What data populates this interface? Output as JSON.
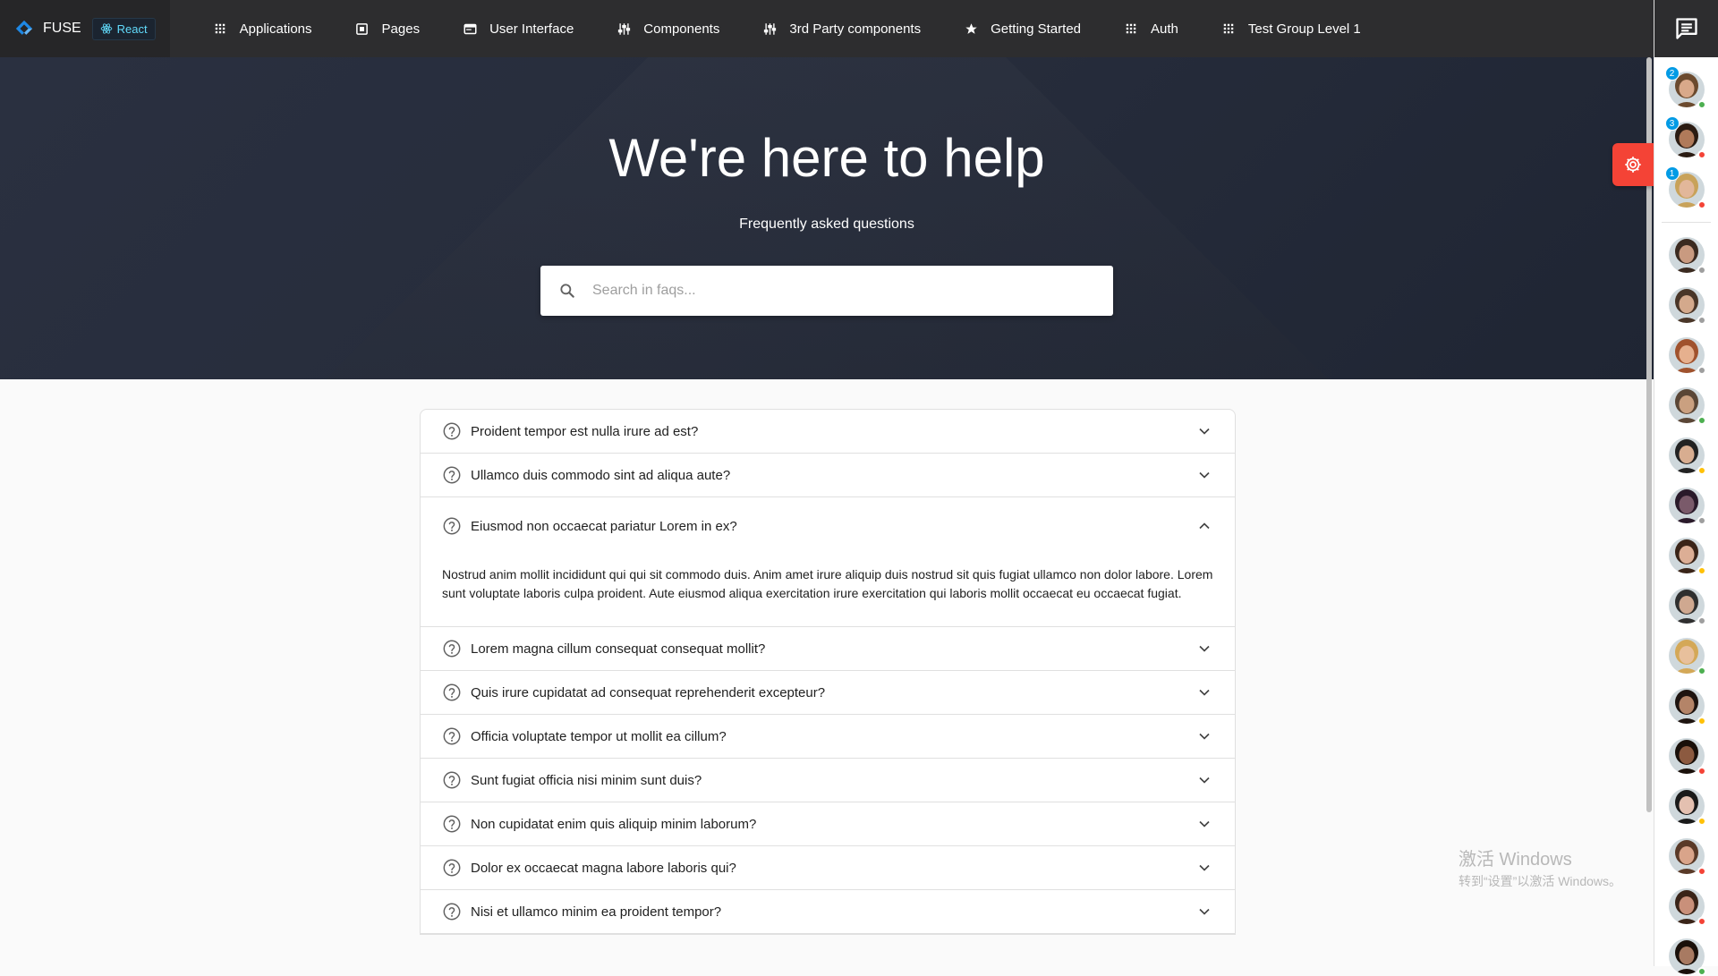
{
  "brand": {
    "name": "FUSE",
    "badge": "React"
  },
  "nav": [
    {
      "label": "Applications",
      "icon": "apps-icon"
    },
    {
      "label": "Pages",
      "icon": "pages-icon"
    },
    {
      "label": "User Interface",
      "icon": "web-icon"
    },
    {
      "label": "Components",
      "icon": "tune-icon"
    },
    {
      "label": "3rd Party components",
      "icon": "tune-icon"
    },
    {
      "label": "Getting Started",
      "icon": "star-icon"
    },
    {
      "label": "Auth",
      "icon": "apps-icon"
    },
    {
      "label": "Test Group Level 1",
      "icon": "apps-icon"
    }
  ],
  "hero": {
    "title": "We're here to help",
    "subtitle": "Frequently asked questions",
    "search_placeholder": "Search in faqs..."
  },
  "faqs": [
    {
      "question": "Proident tempor est nulla irure ad est?",
      "open": false
    },
    {
      "question": "Ullamco duis commodo sint ad aliqua aute?",
      "open": false
    },
    {
      "question": "Eiusmod non occaecat pariatur Lorem in ex?",
      "open": true,
      "answer": "Nostrud anim mollit incididunt qui qui sit commodo duis. Anim amet irure aliquip duis nostrud sit quis fugiat ullamco non dolor labore. Lorem sunt voluptate laboris culpa proident. Aute eiusmod aliqua exercitation irure exercitation qui laboris mollit occaecat eu occaecat fugiat."
    },
    {
      "question": "Lorem magna cillum consequat consequat mollit?",
      "open": false
    },
    {
      "question": "Quis irure cupidatat ad consequat reprehenderit excepteur?",
      "open": false
    },
    {
      "question": "Officia voluptate tempor ut mollit ea cillum?",
      "open": false
    },
    {
      "question": "Sunt fugiat officia nisi minim sunt duis?",
      "open": false
    },
    {
      "question": "Non cupidatat enim quis aliquip minim laborum?",
      "open": false
    },
    {
      "question": "Dolor ex occaecat magna labore laboris qui?",
      "open": false
    },
    {
      "question": "Nisi et ullamco minim ea proident tempor?",
      "open": false
    }
  ],
  "contacts": [
    {
      "unread": "2",
      "status": "#4caf50",
      "skin": "#d9a98a",
      "hair": "#6b4a2e"
    },
    {
      "unread": "3",
      "status": "#f44336",
      "skin": "#b07a5a",
      "hair": "#2a1b12"
    },
    {
      "unread": "1",
      "status": "#f44336",
      "skin": "#e2b79a",
      "hair": "#c8a25a"
    },
    {
      "unread": "",
      "status": "#9e9e9e",
      "skin": "#c99a80",
      "hair": "#3b2a20"
    },
    {
      "unread": "",
      "status": "#9e9e9e",
      "skin": "#d4a98c",
      "hair": "#4a3628"
    },
    {
      "unread": "",
      "status": "#9e9e9e",
      "skin": "#e6b08e",
      "hair": "#a0522d"
    },
    {
      "unread": "",
      "status": "#4caf50",
      "skin": "#caa080",
      "hair": "#5a4636"
    },
    {
      "unread": "",
      "status": "#ffc107",
      "skin": "#d8ad90",
      "hair": "#222222"
    },
    {
      "unread": "",
      "status": "#9e9e9e",
      "skin": "#7a5a6a",
      "hair": "#2a1a2a"
    },
    {
      "unread": "",
      "status": "#ffc107",
      "skin": "#dcae95",
      "hair": "#3a2418"
    },
    {
      "unread": "",
      "status": "#9e9e9e",
      "skin": "#cfa890",
      "hair": "#2f2f2f"
    },
    {
      "unread": "",
      "status": "#4caf50",
      "skin": "#e8c09c",
      "hair": "#d4a857"
    },
    {
      "unread": "",
      "status": "#ffc107",
      "skin": "#b48468",
      "hair": "#1e1410"
    },
    {
      "unread": "",
      "status": "#f44336",
      "skin": "#8c5a40",
      "hair": "#1a100a"
    },
    {
      "unread": "",
      "status": "#ffc107",
      "skin": "#e4c0b0",
      "hair": "#1a1a1a"
    },
    {
      "unread": "",
      "status": "#f44336",
      "skin": "#d9a48a",
      "hair": "#5a3a28"
    },
    {
      "unread": "",
      "status": "#f44336",
      "skin": "#c9907a",
      "hair": "#3a2418"
    },
    {
      "unread": "",
      "status": "#4caf50",
      "skin": "#a87a62",
      "hair": "#1a100a"
    }
  ],
  "watermark": {
    "line1": "激活 Windows",
    "line2": "转到“设置”以激活 Windows。"
  },
  "colors": {
    "topbar": "#2d2d2f",
    "accent": "#039be5",
    "settings": "#f44336"
  }
}
